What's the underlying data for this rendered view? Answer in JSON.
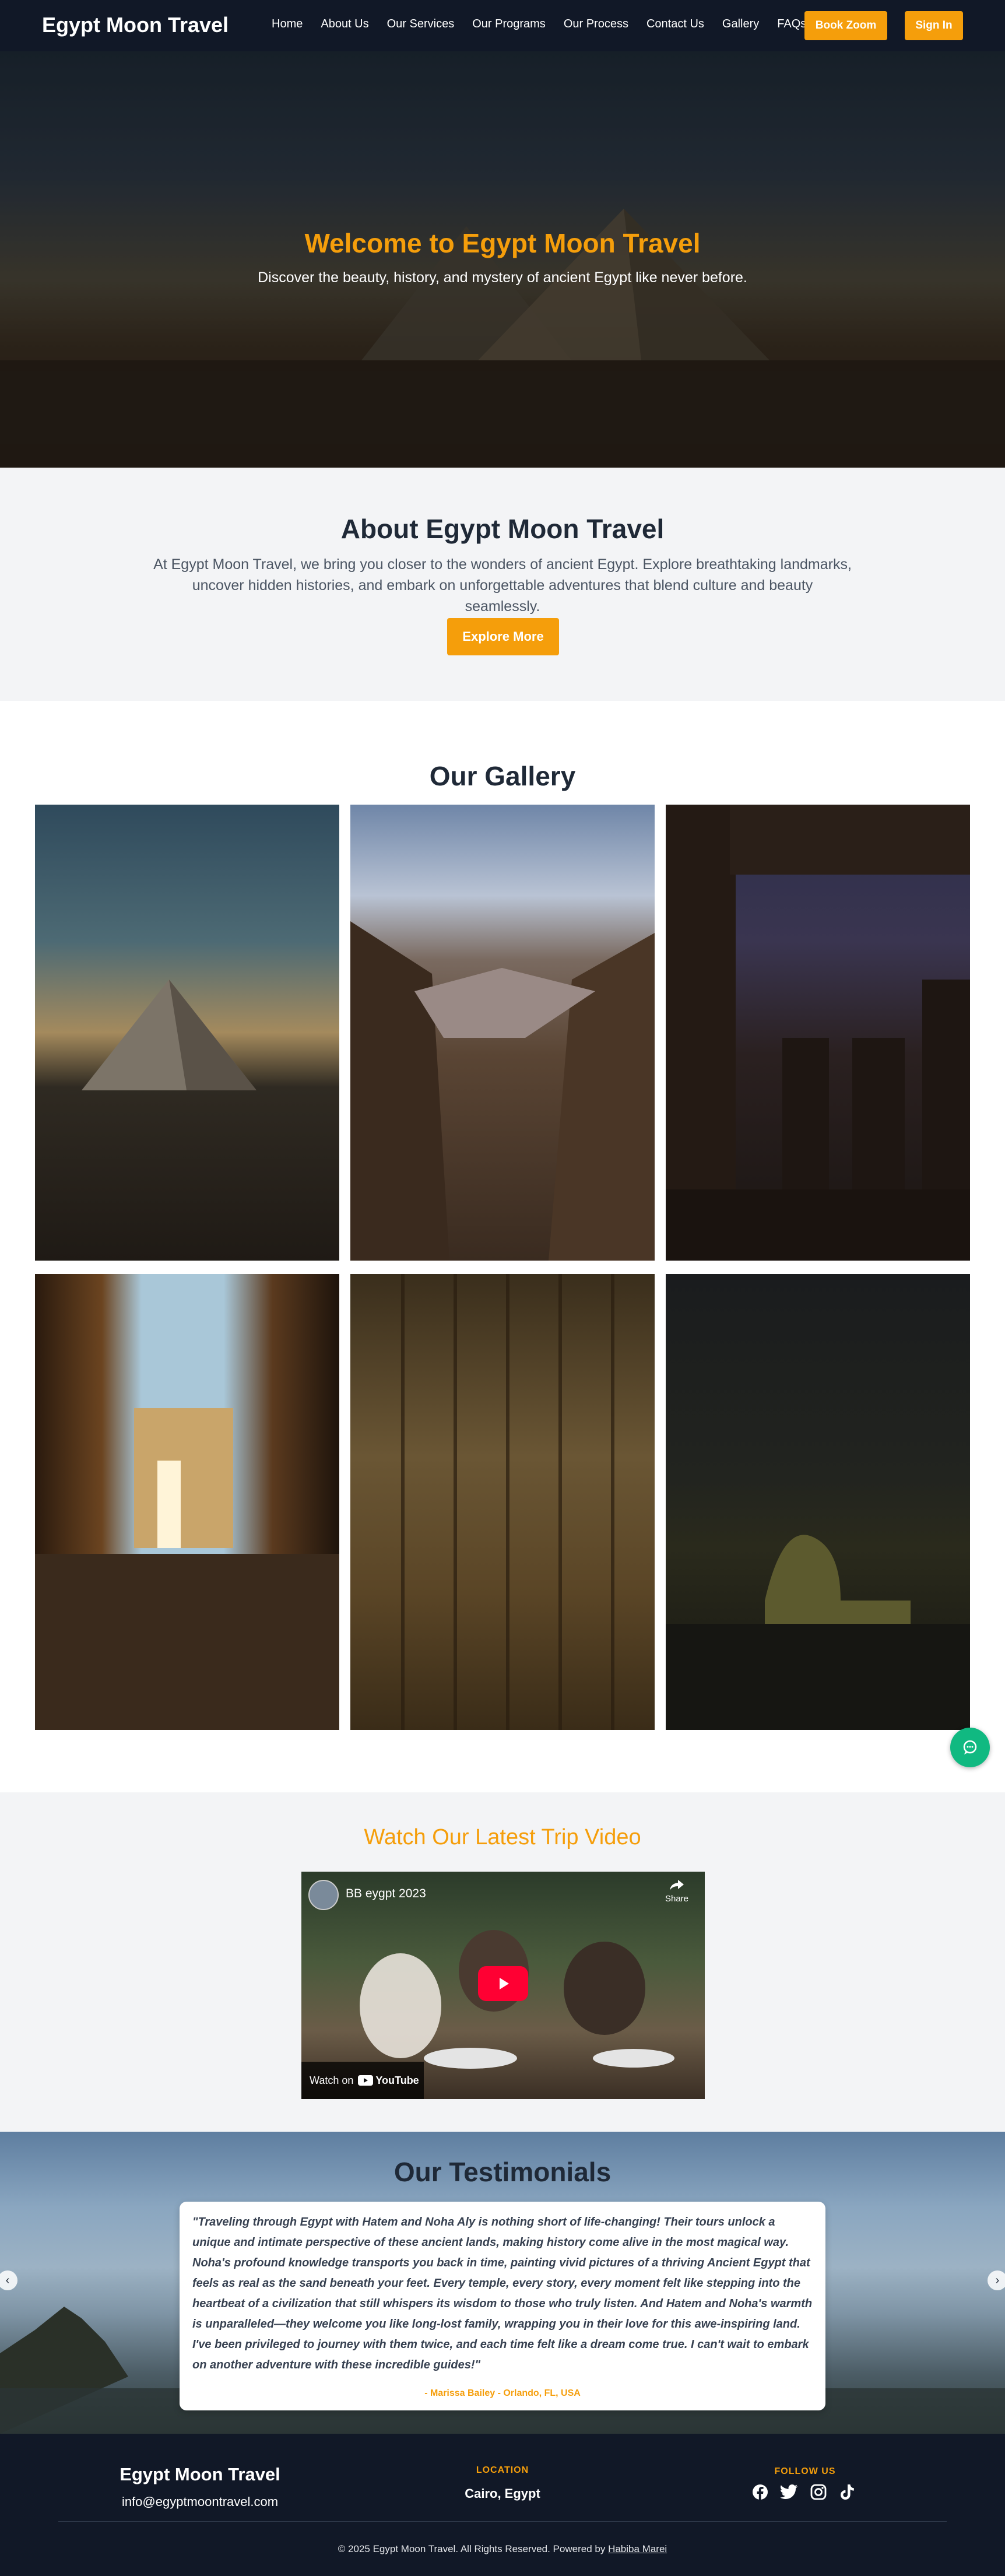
{
  "nav": {
    "brand": "Egypt Moon Travel",
    "links": [
      "Home",
      "About Us",
      "Our Services",
      "Our Programs",
      "Our Process",
      "Contact Us",
      "Gallery",
      "FAQs"
    ],
    "book_label": "Book Zoom",
    "signin_label": "Sign In"
  },
  "hero": {
    "title": "Welcome to Egypt Moon Travel",
    "subtitle": "Discover the beauty, history, and mystery of ancient Egypt like never before."
  },
  "about": {
    "title": "About Egypt Moon Travel",
    "text": "At Egypt Moon Travel, we bring you closer to the wonders of ancient Egypt. Explore breathtaking landmarks, uncover hidden histories, and embark on unforgettable adventures that blend culture and beauty seamlessly.",
    "button": "Explore More"
  },
  "gallery": {
    "title": "Our Gallery"
  },
  "video": {
    "title": "Watch Our Latest Trip Video",
    "video_title": "BB eygpt 2023",
    "share_label": "Share",
    "watch_on": "Watch on",
    "youtube": "YouTube"
  },
  "testimonials": {
    "title": "Our Testimonials",
    "quote": "\"Traveling through Egypt with Hatem and Noha Aly is nothing short of life-changing! Their tours unlock a unique and intimate perspective of these ancient lands, making history come alive in the most magical way. Noha's profound knowledge transports you back in time, painting vivid pictures of a thriving Ancient Egypt that feels as real as the sand beneath your feet. Every temple, every story, every moment felt like stepping into the heartbeat of a civilization that still whispers its wisdom to those who truly listen. And Hatem and Noha's warmth is unparalleled—they welcome you like long-lost family, wrapping you in their love for this awe-inspiring land. I've been privileged to journey with them twice, and each time felt like a dream come true. I can't wait to embark on another adventure with these incredible guides!\"",
    "author": "- Marissa Bailey - Orlando, FL, USA"
  },
  "footer": {
    "brand": "Egypt Moon Travel",
    "email": "info@egyptmoontravel.com",
    "location_heading": "LOCATION",
    "location": "Cairo, Egypt",
    "follow_heading": "FOLLOW US",
    "copyright": "© 2025 Egypt Moon Travel. All Rights Reserved. Powered by",
    "powered_by": "Habiba Marei"
  },
  "colors": {
    "accent": "#f59e0b",
    "nav_bg": "#111827",
    "chat": "#10b981"
  }
}
